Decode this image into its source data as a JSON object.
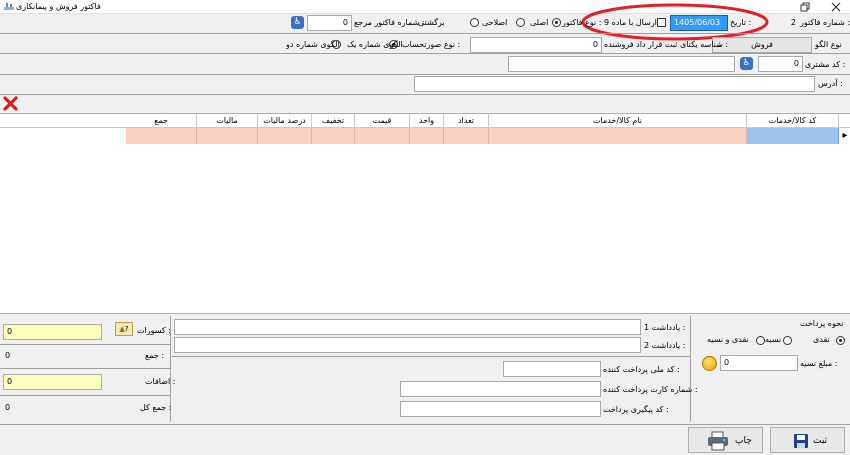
{
  "window": {
    "title": "فاکتور فروش و پیمانکاری",
    "accent_color": "#e81c24"
  },
  "header": {
    "invoice_number_label": "شماره فاکتور :",
    "invoice_number_value": "2",
    "date_label": "تاریخ :",
    "date_value": "1405/06/03",
    "send_article9_label": "ارسال با ماده 9",
    "invoice_type_label": "نوع فاکتور :",
    "invoice_types": [
      "اصلی",
      "اصلاحی",
      "برگشتی"
    ],
    "invoice_type_selected": "اصلی",
    "ref_invoice_label": "شماره فاکتور مرجع :",
    "ref_invoice_value": "0",
    "pattern_type_label": "نوع الگو",
    "pattern_type_value": "فروش",
    "unique_id_label": "شناسه یکتای ثبت قرار داد فروشنده :",
    "unique_id_value": "0",
    "account_type_label": "نوع صورتحساب :",
    "account_types": [
      "الگوی شماره یک",
      "الگوی شماره دو"
    ],
    "account_type_selected": "الگوی شماره یک",
    "customer_code_label": "کد مشتری :",
    "customer_code_value": "0",
    "customer_name_value": "",
    "address_label": "آدرس :",
    "address_value": ""
  },
  "grid": {
    "columns": [
      "کد کالا/خدمات",
      "نام کالا/خدمات",
      "تعداد",
      "واحد",
      "قیمت",
      "تخفیف",
      "درصد مالیات",
      "مالیات",
      "جمع"
    ],
    "row_marker": "▸"
  },
  "payment": {
    "title": "نحوه پرداخت",
    "methods": [
      "نقدی",
      "نسیه",
      "نقدی و نسیه"
    ],
    "selected": "نقدی",
    "credit_amount_label": "مبلغ نسیه :",
    "credit_amount_value": "0"
  },
  "notes": {
    "note1_label": "یادداشت 1 :",
    "note1_value": "",
    "note2_label": "یادداشت 2 :",
    "note2_value": "",
    "payer_national_id_label": "کد ملی پرداخت کننده :",
    "payer_card_label": "شماره کارت پرداخت کننده :",
    "tracking_code_label": "کد پیگیری پرداخت :"
  },
  "totals": {
    "deductions_label": "کسورات :",
    "deductions_value": "0",
    "sum_label": "جمع :",
    "sum_value": "0",
    "additions_label": "اضافات :",
    "additions_value": "0",
    "grand_total_label": "جمع کل :",
    "grand_total_value": "0",
    "help_glyph": "?"
  },
  "footer": {
    "save_label": "ثبت",
    "print_label": "چاپ"
  }
}
